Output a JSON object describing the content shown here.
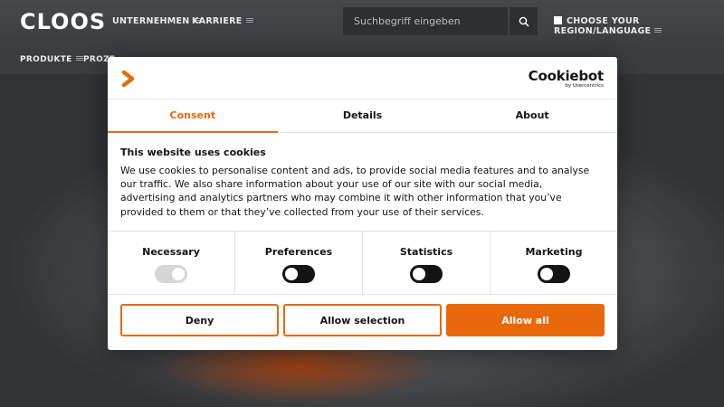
{
  "header": {
    "logo": "CLOOS",
    "nav": [
      "UNTERNEHMEN",
      "KARRIERE"
    ],
    "search_placeholder": "Suchbegriff eingeben",
    "region": "CHOOSE YOUR REGION/LANGUAGE",
    "subnav": [
      "PRODUKTE",
      "PROZE"
    ]
  },
  "dialog": {
    "brand_name": "Cookiebot",
    "brand_by": "by Usercentrics",
    "tabs": [
      "Consent",
      "Details",
      "About"
    ],
    "active_tab": "Consent",
    "title": "This website uses cookies",
    "text": "We use cookies to personalise content and ads, to provide social media features and to analyse our traffic. We also share information about your use of our site with our social media, advertising and analytics partners who may combine it with other information that you’ve provided to them or that they’ve collected from your use of their services.",
    "preferences": [
      {
        "label": "Necessary",
        "enabled": true,
        "locked": true
      },
      {
        "label": "Preferences",
        "enabled": false
      },
      {
        "label": "Statistics",
        "enabled": false
      },
      {
        "label": "Marketing",
        "enabled": false
      }
    ],
    "buttons": {
      "deny": "Deny",
      "allow_selection": "Allow selection",
      "allow_all": "Allow all"
    }
  },
  "colors": {
    "accent": "#e8690c",
    "header_bg": "#3b3f42",
    "text": "#141414"
  }
}
